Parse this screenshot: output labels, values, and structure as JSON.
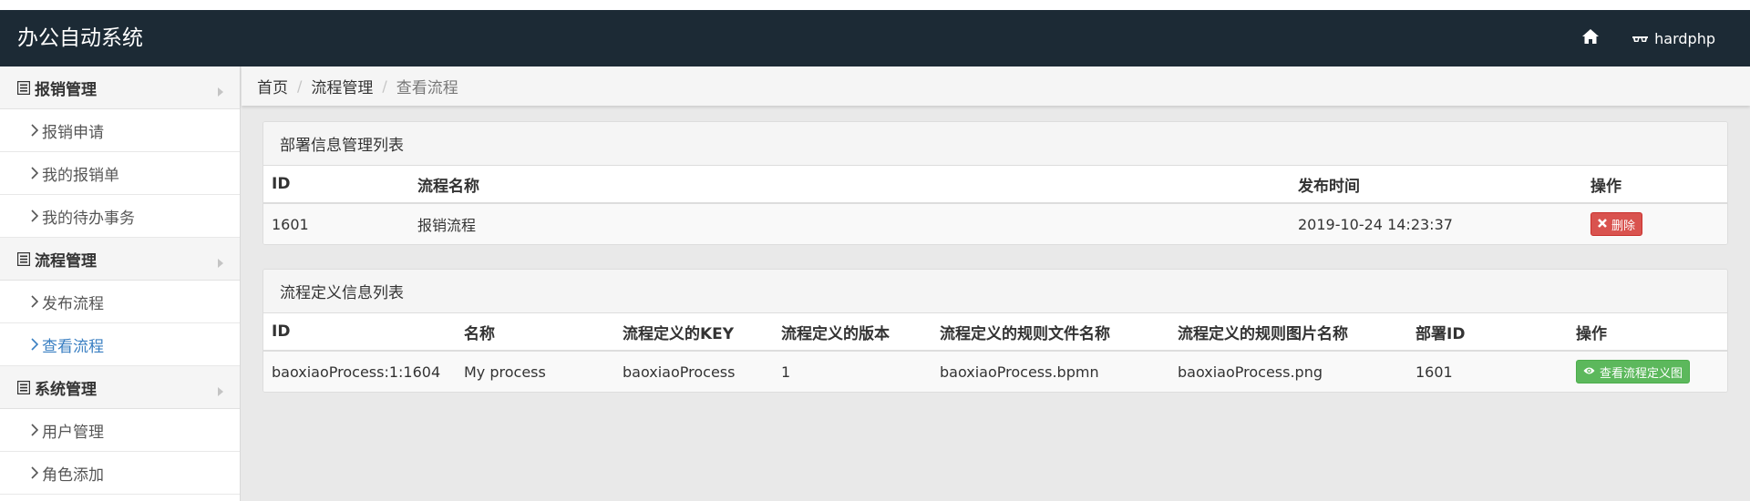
{
  "app": {
    "title": "办公自动系统"
  },
  "navbar": {
    "home_icon": "home-icon",
    "user_icon": "glasses-icon",
    "user_name": "hardphp"
  },
  "colors": {
    "navbar_bg": "#1c2a35",
    "danger": "#d9534f",
    "success": "#5cb85c",
    "active_link": "#3a7fc2"
  },
  "sidebar": {
    "groups": [
      {
        "label": "报销管理",
        "items": [
          {
            "label": "报销申请"
          },
          {
            "label": "我的报销单"
          },
          {
            "label": "我的待办事务"
          }
        ]
      },
      {
        "label": "流程管理",
        "items": [
          {
            "label": "发布流程"
          },
          {
            "label": "查看流程",
            "active": true
          }
        ]
      },
      {
        "label": "系统管理",
        "items": [
          {
            "label": "用户管理"
          },
          {
            "label": "角色添加"
          }
        ]
      }
    ]
  },
  "breadcrumb": {
    "items": [
      "首页",
      "流程管理",
      "查看流程"
    ],
    "separator": "/"
  },
  "deploy_panel": {
    "title": "部署信息管理列表",
    "columns": [
      "ID",
      "流程名称",
      "发布时间",
      "操作"
    ],
    "rows": [
      {
        "id": "1601",
        "name": "报销流程",
        "time": "2019-10-24 14:23:37",
        "action_label": "删除"
      }
    ]
  },
  "definition_panel": {
    "title": "流程定义信息列表",
    "columns": [
      "ID",
      "名称",
      "流程定义的KEY",
      "流程定义的版本",
      "流程定义的规则文件名称",
      "流程定义的规则图片名称",
      "部署ID",
      "操作"
    ],
    "rows": [
      {
        "id": "baoxiaoProcess:1:1604",
        "name": "My process",
        "key": "baoxiaoProcess",
        "version": "1",
        "bpmn": "baoxiaoProcess.bpmn",
        "png": "baoxiaoProcess.png",
        "deployment_id": "1601",
        "action_label": "查看流程定义图"
      }
    ]
  }
}
